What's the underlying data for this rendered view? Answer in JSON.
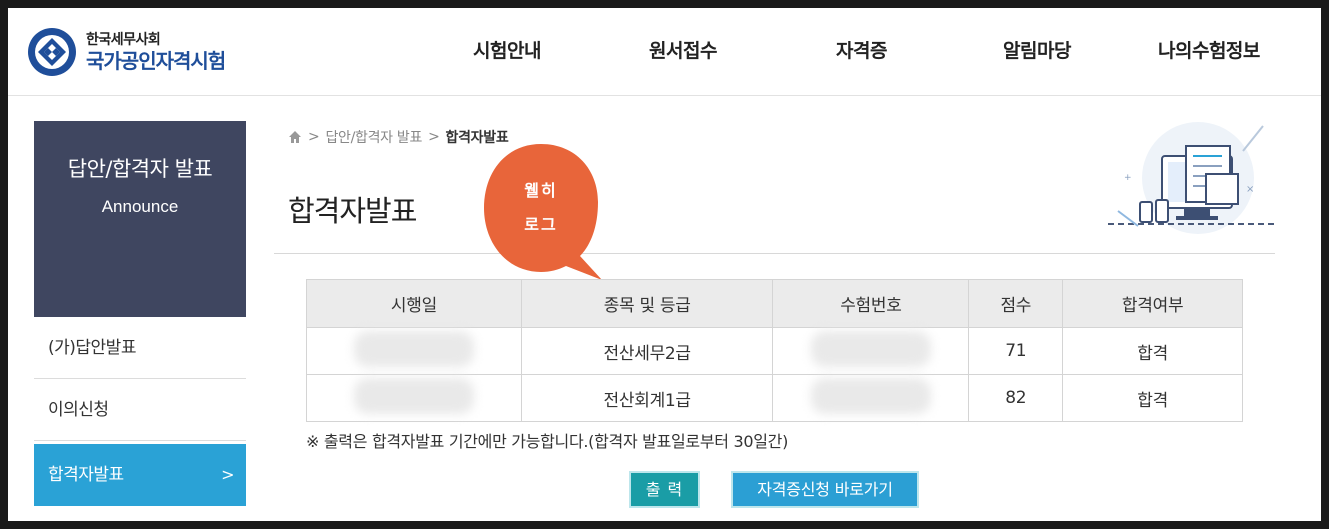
{
  "header": {
    "logo_sub": "한국세무사회",
    "logo_main": "국가공인자격시험",
    "nav": [
      "시험안내",
      "원서접수",
      "자격증",
      "알림마당",
      "나의수험정보"
    ]
  },
  "sidebar": {
    "title": "답안/합격자 발표",
    "subtitle": "Announce",
    "items": [
      {
        "label": "(가)답안발표"
      },
      {
        "label": "이의신청"
      },
      {
        "label": "합격자발표",
        "arrow": ">"
      }
    ]
  },
  "breadcrumb": {
    "sep1": ">",
    "parent": "답안/합격자 발표",
    "sep2": ">",
    "current": "합격자발표"
  },
  "page_title": "합격자발표",
  "watermark": {
    "line1": "웰히",
    "line2": "로그",
    "color": "#e8653a"
  },
  "table": {
    "headers": [
      "시행일",
      "종목 및 등급",
      "수험번호",
      "점수",
      "합격여부"
    ],
    "rows": [
      {
        "subject": "전산세무2급",
        "score": "71",
        "result": "합격"
      },
      {
        "subject": "전산회계1급",
        "score": "82",
        "result": "합격"
      }
    ]
  },
  "note": "※ 출력은 합격자발표 기간에만 가능합니다.(합격자 발표일로부터 30일간)",
  "buttons": {
    "print": "출 력",
    "certificate": "자격증신청 바로가기"
  },
  "colors": {
    "sidebar_title_bg": "#3f4660",
    "sidebar_active_bg": "#2aa2d6",
    "logo_blue": "#1f4e9a",
    "print_button": "#1a9da6",
    "cert_button": "#2b9fd4"
  }
}
